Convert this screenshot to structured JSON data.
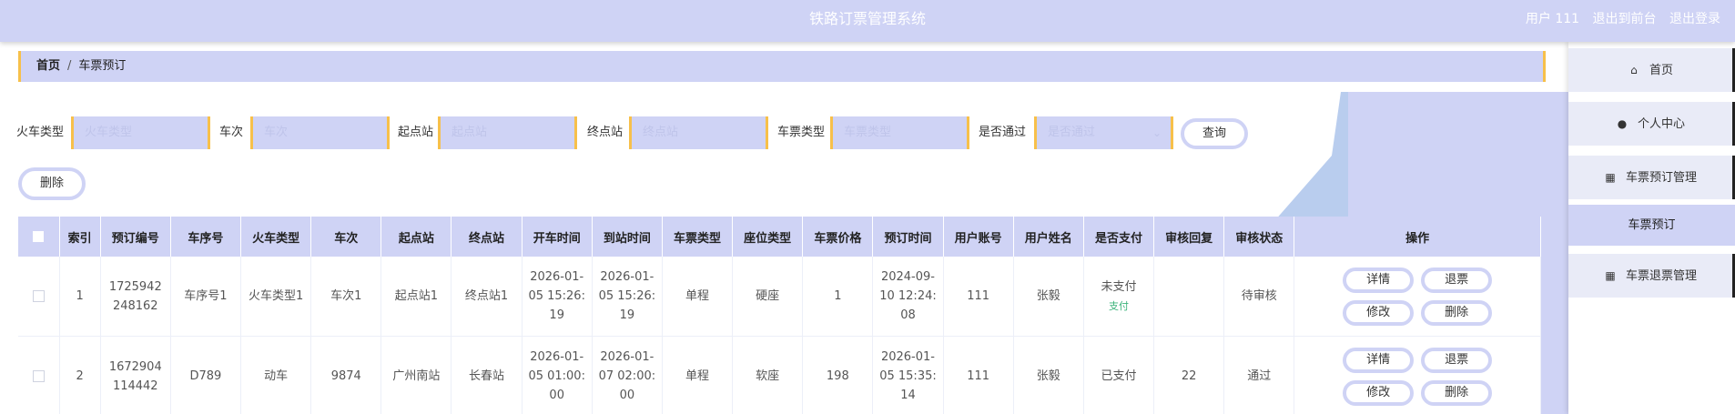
{
  "header": {
    "title": "铁路订票管理系统",
    "user_label": "用户 111",
    "exit_front": "退出到前台",
    "logout": "退出登录"
  },
  "breadcrumb": {
    "home": "首页",
    "sep": "/",
    "current": "车票预订"
  },
  "filters": {
    "train_type": {
      "label": "火车类型",
      "placeholder": "火车类型"
    },
    "train_no": {
      "label": "车次",
      "placeholder": "车次"
    },
    "start": {
      "label": "起点站",
      "placeholder": "起点站"
    },
    "end": {
      "label": "终点站",
      "placeholder": "终点站"
    },
    "ticket_type": {
      "label": "车票类型",
      "placeholder": "车票类型"
    },
    "approved": {
      "label": "是否通过",
      "placeholder": "是否通过"
    },
    "query": "查询",
    "delete": "删除"
  },
  "table": {
    "headers": [
      "索引",
      "预订编号",
      "车序号",
      "火车类型",
      "车次",
      "起点站",
      "终点站",
      "开车时间",
      "到站时间",
      "车票类型",
      "座位类型",
      "车票价格",
      "预订时间",
      "用户账号",
      "用户姓名",
      "是否支付",
      "审核回复",
      "审核状态",
      "操作"
    ],
    "rows": [
      {
        "index": "1",
        "booking_no_1": "1725942",
        "booking_no_2": "248162",
        "seq": "车序号1",
        "train_type": "火车类型1",
        "train_no": "车次1",
        "start": "起点站1",
        "end": "终点站1",
        "depart_1": "2026-01-",
        "depart_2": "05 15:26:",
        "depart_3": "19",
        "arrive_1": "2026-01-",
        "arrive_2": "05 15:26:",
        "arrive_3": "19",
        "ticket_type": "单程",
        "seat_type": "硬座",
        "price": "1",
        "booked_1": "2024-09-",
        "booked_2": "10 12:24:",
        "booked_3": "08",
        "account": "111",
        "name": "张毅",
        "paid": "未支付",
        "pay_link": "支付",
        "reply": "",
        "status": "待审核"
      },
      {
        "index": "2",
        "booking_no_1": "1672904",
        "booking_no_2": "114442",
        "seq": "D789",
        "train_type": "动车",
        "train_no": "9874",
        "start": "广州南站",
        "end": "长春站",
        "depart_1": "2026-01-",
        "depart_2": "05 01:00:",
        "depart_3": "00",
        "arrive_1": "2026-01-",
        "arrive_2": "07 02:00:",
        "arrive_3": "00",
        "ticket_type": "单程",
        "seat_type": "软座",
        "price": "198",
        "booked_1": "2026-01-",
        "booked_2": "05 15:35:",
        "booked_3": "14",
        "account": "111",
        "name": "张毅",
        "paid": "已支付",
        "pay_link": "",
        "reply": "22",
        "status": "通过"
      }
    ],
    "ops": {
      "detail": "详情",
      "refund": "退票",
      "edit": "修改",
      "delete": "删除"
    }
  },
  "sidebar": {
    "home": "首页",
    "profile": "个人中心",
    "booking_mgmt": "车票预订管理",
    "booking_sub": "车票预订",
    "refund_mgmt": "车票退票管理"
  },
  "icons": {
    "home": "home-icon",
    "user": "user-icon",
    "grid": "grid-icon"
  },
  "colors": {
    "accent": "#cfd3f5",
    "border_accent": "#f7c04a",
    "paid_link": "#3bb37a"
  }
}
